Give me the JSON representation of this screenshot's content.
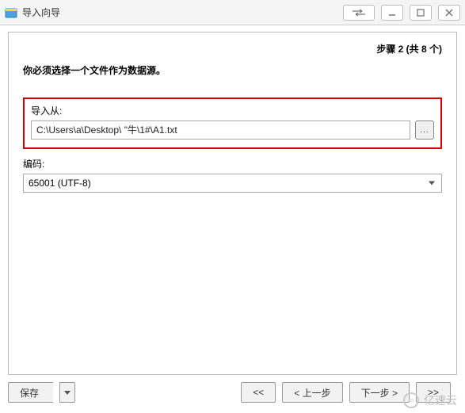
{
  "window": {
    "title": "导入向导"
  },
  "step": "步骤 2 (共 8 个)",
  "instruction": "你必须选择一个文件作为数据源。",
  "import_from": {
    "label": "导入从:",
    "value": "C:\\Users\\a\\Desktop\\                           \"牛\\1#\\A1.txt",
    "browse_label": "..."
  },
  "encoding": {
    "label": "编码:",
    "selected": "65001 (UTF-8)"
  },
  "footer": {
    "save": "保存",
    "first": "<<",
    "prev": "< 上一步",
    "next": "下一步 >",
    "last": ">>"
  },
  "watermark": "亿速云"
}
